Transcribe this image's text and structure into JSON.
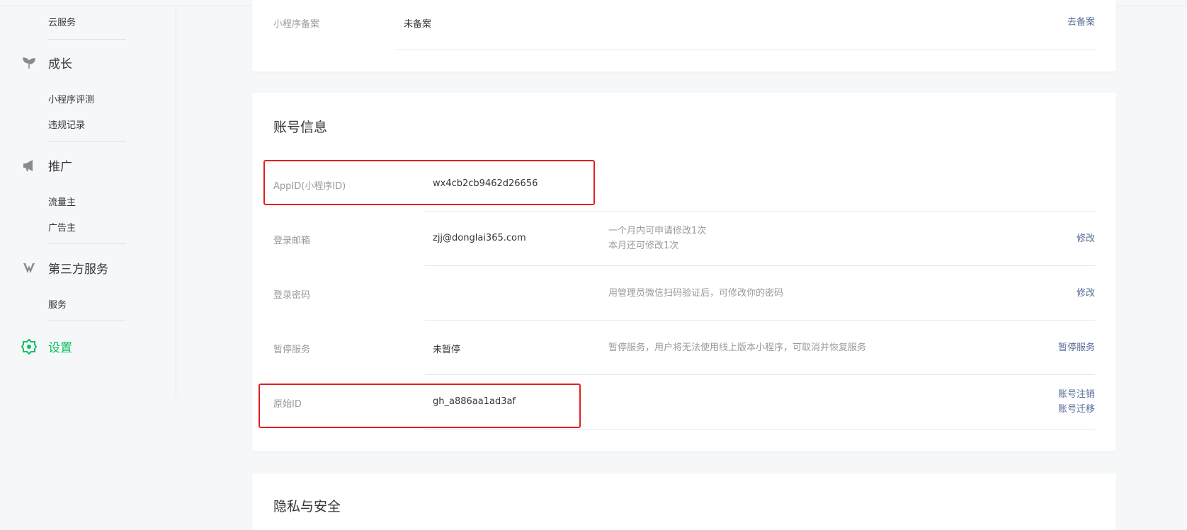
{
  "sidebar": {
    "cloud_service": "云服务",
    "growth": {
      "label": "成长",
      "icon": "sprout-icon",
      "items": [
        "小程序评测",
        "违规记录"
      ]
    },
    "promotion": {
      "label": "推广",
      "icon": "megaphone-icon",
      "items": [
        "流量主",
        "广告主"
      ]
    },
    "third_party": {
      "label": "第三方服务",
      "icon": "third-party-icon",
      "items": [
        "服务"
      ]
    },
    "settings": {
      "label": "设置",
      "icon": "gear-icon",
      "active_color": "#07c160"
    }
  },
  "filing": {
    "label": "小程序备案",
    "value": "未备案",
    "action": "去备案"
  },
  "account": {
    "title": "账号信息",
    "appid": {
      "label": "AppID(小程序ID)",
      "value": "wx4cb2cb9462d26656"
    },
    "email": {
      "label": "登录邮箱",
      "value": "zjj@donglai365.com",
      "desc1": "一个月内可申请修改1次",
      "desc2": "本月还可修改1次",
      "action": "修改"
    },
    "password": {
      "label": "登录密码",
      "desc": "用管理员微信扫码验证后，可修改你的密码",
      "action": "修改"
    },
    "suspend": {
      "label": "暂停服务",
      "value": "未暂停",
      "desc": "暂停服务，用户将无法使用线上版本小程序，可取消并恢复服务",
      "action": "暂停服务"
    },
    "original_id": {
      "label": "原始ID",
      "value": "gh_a886aa1ad3af",
      "action1": "账号注销",
      "action2": "账号迁移"
    }
  },
  "privacy": {
    "title": "隐私与安全"
  },
  "colors": {
    "highlight": "#e02020",
    "link": "#576b95",
    "accent": "#07c160"
  }
}
